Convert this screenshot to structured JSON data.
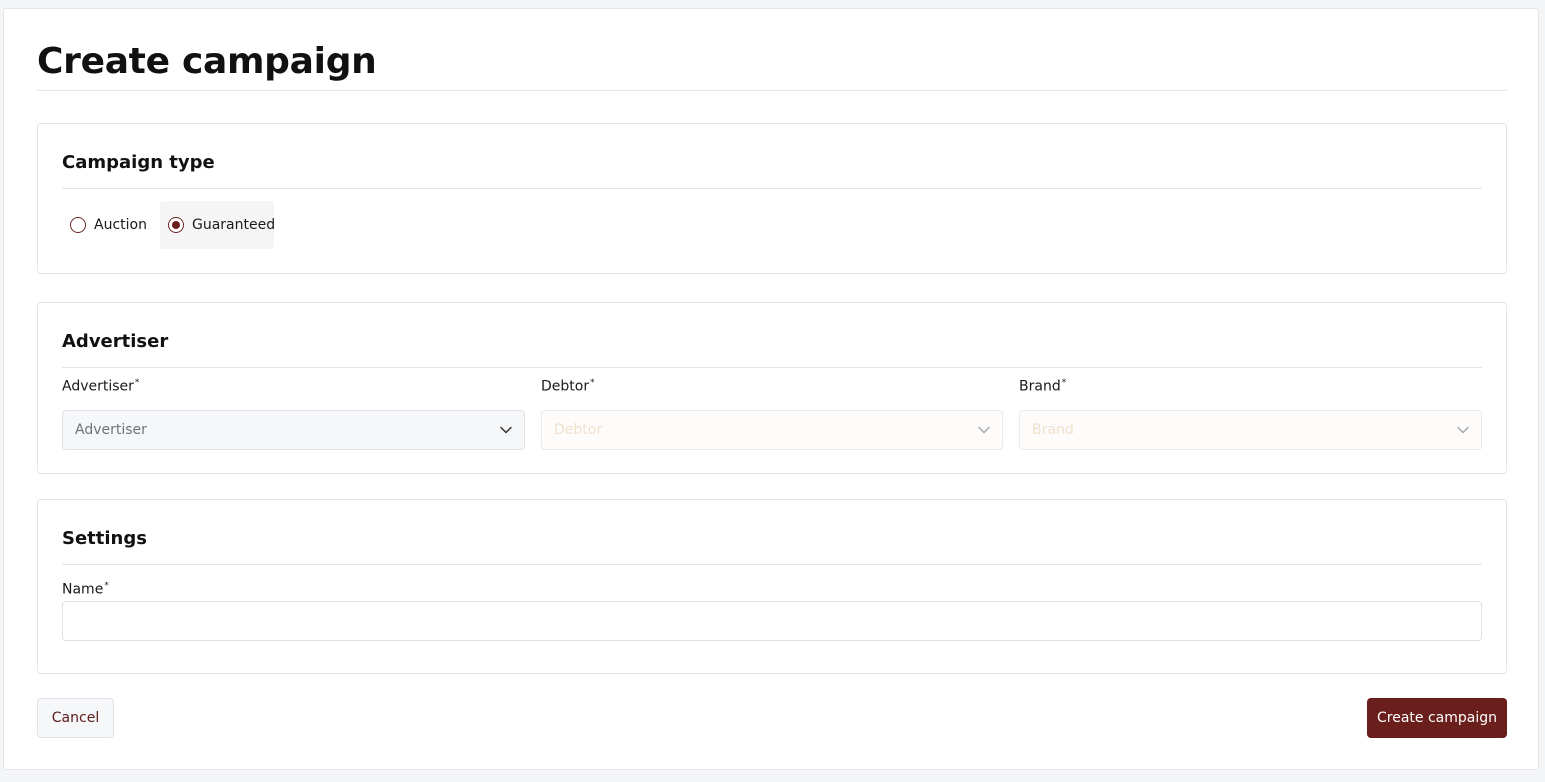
{
  "page": {
    "title": "Create campaign"
  },
  "campaign_type": {
    "heading": "Campaign type",
    "options": [
      {
        "label": "Auction",
        "selected": false
      },
      {
        "label": "Guaranteed",
        "selected": true
      }
    ]
  },
  "advertiser": {
    "heading": "Advertiser",
    "required_mark": "*",
    "fields": {
      "advertiser": {
        "label": "Advertiser",
        "placeholder": "Advertiser",
        "disabled": false
      },
      "debtor": {
        "label": "Debtor",
        "placeholder": "Debtor",
        "disabled": true
      },
      "brand": {
        "label": "Brand",
        "placeholder": "Brand",
        "disabled": true
      }
    }
  },
  "settings": {
    "heading": "Settings",
    "name": {
      "label": "Name",
      "value": ""
    }
  },
  "actions": {
    "cancel_label": "Cancel",
    "create_label": "Create campaign"
  },
  "colors": {
    "accent": "#6b1f1c",
    "border": "#e3e5e8",
    "select_bg": "#f6f7f9"
  },
  "icons": {
    "select_indicator": "chevron-down-icon",
    "radio": "radio-button"
  }
}
